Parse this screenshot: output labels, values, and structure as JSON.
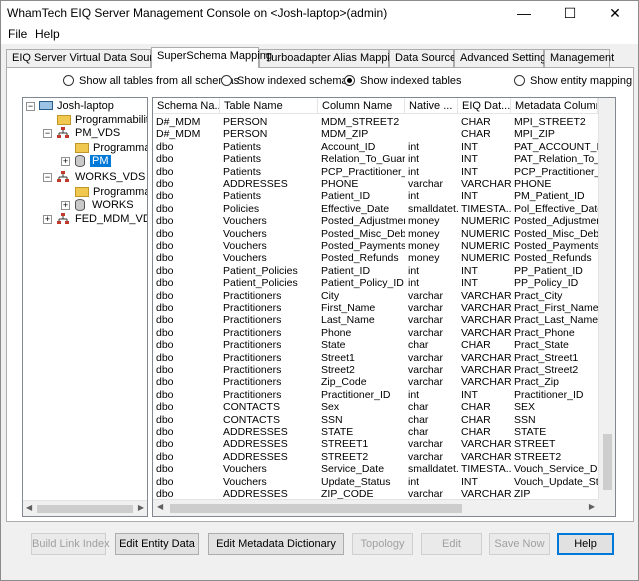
{
  "window": {
    "title": "WhamTech EIQ Server Management Console on <Josh-laptop>(admin)",
    "controls": {
      "minimize": "—",
      "maximize": "☐",
      "close": "✕"
    }
  },
  "menu": {
    "file": "File",
    "help": "Help"
  },
  "tabs": [
    "EIQ Server Virtual Data Sources",
    "SuperSchema Mapping",
    "Turboadapter Alias Mapping",
    "Data Sources",
    "Advanced Settings",
    "Management"
  ],
  "active_tab": "SuperSchema Mapping",
  "view_options": {
    "all_tables": "Show all tables from all schemas",
    "indexed_schemas": "Show indexed schemas",
    "indexed_tables": "Show indexed tables",
    "entity_mapping": "Show entity mapping",
    "selected": "Show indexed tables"
  },
  "tree": {
    "root": "Josh-laptop",
    "nodes": {
      "programmability_1": "Programmability",
      "pm_vds": "PM_VDS",
      "programmab_2": "Programmab",
      "pm": "PM",
      "works_vds": "WORKS_VDS",
      "programmab_3": "Programmab",
      "works": "WORKS",
      "fed_mdm_vds": "FED_MDM_VDS"
    },
    "expander_plus": "+",
    "expander_minus": "−"
  },
  "grid": {
    "columns": [
      "Schema Na...",
      "Table Name",
      "Column Name",
      "Native ...",
      "EIQ Dat...",
      "Metadata Column"
    ],
    "rows": [
      [
        "D#_MDM",
        "PERSON",
        "MDM_STREET2",
        "",
        "CHAR",
        "MPI_STREET2"
      ],
      [
        "D#_MDM",
        "PERSON",
        "MDM_ZIP",
        "",
        "CHAR",
        "MPI_ZIP"
      ],
      [
        "dbo",
        "Patients",
        "Account_ID",
        "int",
        "INT",
        "PAT_ACCOUNT_ID"
      ],
      [
        "dbo",
        "Patients",
        "Relation_To_Guar...",
        "int",
        "INT",
        "PAT_Relation_To_Gu"
      ],
      [
        "dbo",
        "Patients",
        "PCP_Practitioner_...",
        "int",
        "INT",
        "PCP_Practitioner_ID"
      ],
      [
        "dbo",
        "ADDRESSES",
        "PHONE",
        "varchar",
        "VARCHAR",
        "PHONE"
      ],
      [
        "dbo",
        "Patients",
        "Patient_ID",
        "int",
        "INT",
        "PM_Patient_ID"
      ],
      [
        "dbo",
        "Policies",
        "Effective_Date",
        "smalldatet...",
        "TIMESTA...",
        "Pol_Effective_Date"
      ],
      [
        "dbo",
        "Vouchers",
        "Posted_Adjustments",
        "money",
        "NUMERIC",
        "Posted_Adjustments"
      ],
      [
        "dbo",
        "Vouchers",
        "Posted_Misc_Deb...",
        "money",
        "NUMERIC",
        "Posted_Misc_Debits"
      ],
      [
        "dbo",
        "Vouchers",
        "Posted_Payments",
        "money",
        "NUMERIC",
        "Posted_Payments"
      ],
      [
        "dbo",
        "Vouchers",
        "Posted_Refunds",
        "money",
        "NUMERIC",
        "Posted_Refunds"
      ],
      [
        "dbo",
        "Patient_Policies",
        "Patient_ID",
        "int",
        "INT",
        "PP_Patient_ID"
      ],
      [
        "dbo",
        "Patient_Policies",
        "Patient_Policy_ID",
        "int",
        "INT",
        "PP_Policy_ID"
      ],
      [
        "dbo",
        "Practitioners",
        "City",
        "varchar",
        "VARCHAR",
        "Pract_City"
      ],
      [
        "dbo",
        "Practitioners",
        "First_Name",
        "varchar",
        "VARCHAR",
        "Pract_First_Name"
      ],
      [
        "dbo",
        "Practitioners",
        "Last_Name",
        "varchar",
        "VARCHAR",
        "Pract_Last_Name"
      ],
      [
        "dbo",
        "Practitioners",
        "Phone",
        "varchar",
        "VARCHAR",
        "Pract_Phone"
      ],
      [
        "dbo",
        "Practitioners",
        "State",
        "char",
        "CHAR",
        "Pract_State"
      ],
      [
        "dbo",
        "Practitioners",
        "Street1",
        "varchar",
        "VARCHAR",
        "Pract_Street1"
      ],
      [
        "dbo",
        "Practitioners",
        "Street2",
        "varchar",
        "VARCHAR",
        "Pract_Street2"
      ],
      [
        "dbo",
        "Practitioners",
        "Zip_Code",
        "varchar",
        "VARCHAR",
        "Pract_Zip"
      ],
      [
        "dbo",
        "Practitioners",
        "Practitioner_ID",
        "int",
        "INT",
        "Practitioner_ID"
      ],
      [
        "dbo",
        "CONTACTS",
        "Sex",
        "char",
        "CHAR",
        "SEX"
      ],
      [
        "dbo",
        "CONTACTS",
        "SSN",
        "char",
        "CHAR",
        "SSN"
      ],
      [
        "dbo",
        "ADDRESSES",
        "STATE",
        "char",
        "CHAR",
        "STATE"
      ],
      [
        "dbo",
        "ADDRESSES",
        "STREET1",
        "varchar",
        "VARCHAR",
        "STREET"
      ],
      [
        "dbo",
        "ADDRESSES",
        "STREET2",
        "varchar",
        "VARCHAR",
        "STREET2"
      ],
      [
        "dbo",
        "Vouchers",
        "Service_Date",
        "smalldatet...",
        "TIMESTA...",
        "Vouch_Service_Date"
      ],
      [
        "dbo",
        "Vouchers",
        "Update_Status",
        "int",
        "INT",
        "Vouch_Update_Statu"
      ],
      [
        "dbo",
        "ADDRESSES",
        "ZIP_CODE",
        "varchar",
        "VARCHAR",
        "ZIP"
      ]
    ]
  },
  "scroll": {
    "left_arrow": "◀",
    "right_arrow": "▶"
  },
  "buttons": {
    "build_link_index": "Build Link Index",
    "edit_entity_data": "Edit Entity Data",
    "edit_metadata_dictionary": "Edit Metadata Dictionary",
    "topology": "Topology",
    "edit": "Edit",
    "save_now": "Save Now",
    "help": "Help"
  },
  "colors": {
    "selection": "#0078d7",
    "panel": "#f0f0f0"
  }
}
